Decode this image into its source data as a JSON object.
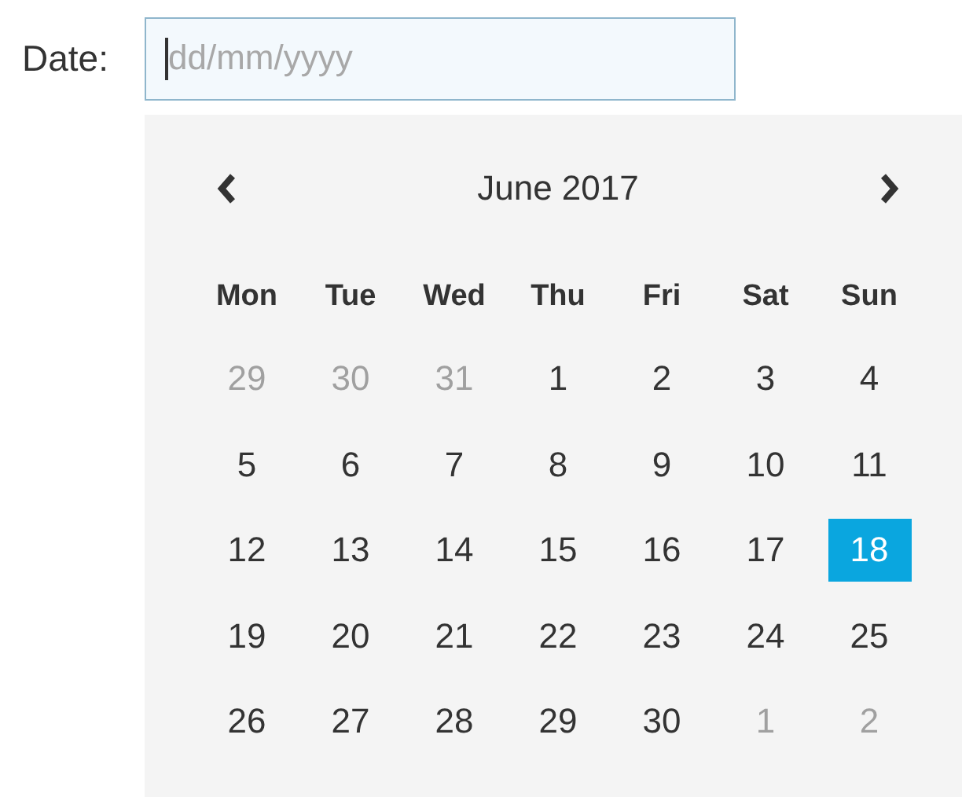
{
  "date_field": {
    "label": "Date:",
    "placeholder": "dd/mm/yyyy",
    "focused": true
  },
  "calendar": {
    "title": "June 2017",
    "weekdays": [
      "Mon",
      "Tue",
      "Wed",
      "Thu",
      "Fri",
      "Sat",
      "Sun"
    ],
    "days": [
      {
        "text": "29",
        "other_month": true,
        "selected": false
      },
      {
        "text": "30",
        "other_month": true,
        "selected": false
      },
      {
        "text": "31",
        "other_month": true,
        "selected": false
      },
      {
        "text": "1",
        "other_month": false,
        "selected": false
      },
      {
        "text": "2",
        "other_month": false,
        "selected": false
      },
      {
        "text": "3",
        "other_month": false,
        "selected": false
      },
      {
        "text": "4",
        "other_month": false,
        "selected": false
      },
      {
        "text": "5",
        "other_month": false,
        "selected": false
      },
      {
        "text": "6",
        "other_month": false,
        "selected": false
      },
      {
        "text": "7",
        "other_month": false,
        "selected": false
      },
      {
        "text": "8",
        "other_month": false,
        "selected": false
      },
      {
        "text": "9",
        "other_month": false,
        "selected": false
      },
      {
        "text": "10",
        "other_month": false,
        "selected": false
      },
      {
        "text": "11",
        "other_month": false,
        "selected": false
      },
      {
        "text": "12",
        "other_month": false,
        "selected": false
      },
      {
        "text": "13",
        "other_month": false,
        "selected": false
      },
      {
        "text": "14",
        "other_month": false,
        "selected": false
      },
      {
        "text": "15",
        "other_month": false,
        "selected": false
      },
      {
        "text": "16",
        "other_month": false,
        "selected": false
      },
      {
        "text": "17",
        "other_month": false,
        "selected": false
      },
      {
        "text": "18",
        "other_month": false,
        "selected": true
      },
      {
        "text": "19",
        "other_month": false,
        "selected": false
      },
      {
        "text": "20",
        "other_month": false,
        "selected": false
      },
      {
        "text": "21",
        "other_month": false,
        "selected": false
      },
      {
        "text": "22",
        "other_month": false,
        "selected": false
      },
      {
        "text": "23",
        "other_month": false,
        "selected": false
      },
      {
        "text": "24",
        "other_month": false,
        "selected": false
      },
      {
        "text": "25",
        "other_month": false,
        "selected": false
      },
      {
        "text": "26",
        "other_month": false,
        "selected": false
      },
      {
        "text": "27",
        "other_month": false,
        "selected": false
      },
      {
        "text": "28",
        "other_month": false,
        "selected": false
      },
      {
        "text": "29",
        "other_month": false,
        "selected": false
      },
      {
        "text": "30",
        "other_month": false,
        "selected": false
      },
      {
        "text": "1",
        "other_month": true,
        "selected": false
      },
      {
        "text": "2",
        "other_month": true,
        "selected": false
      }
    ]
  }
}
